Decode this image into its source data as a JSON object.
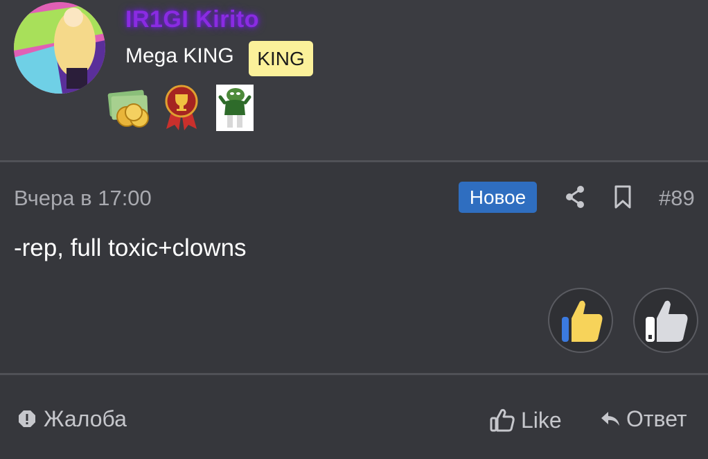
{
  "author": {
    "username": "IR1GI Kirito",
    "title": "Mega KING",
    "title_badge": "KING",
    "awards": [
      "money-award-icon",
      "trophy-medal-icon",
      "pepe-award-icon"
    ]
  },
  "post": {
    "date": "Вчера в 17:00",
    "new_badge": "Новое",
    "number": "#89",
    "body": "-rep, full toxic+clowns"
  },
  "actions": {
    "complaint": "Жалоба",
    "like": "Like",
    "reply": "Ответ"
  },
  "colors": {
    "username": "#8a2be2",
    "new_badge_bg": "#2f6ec0",
    "king_badge_bg": "#fbf19a",
    "background": "#36373c"
  }
}
